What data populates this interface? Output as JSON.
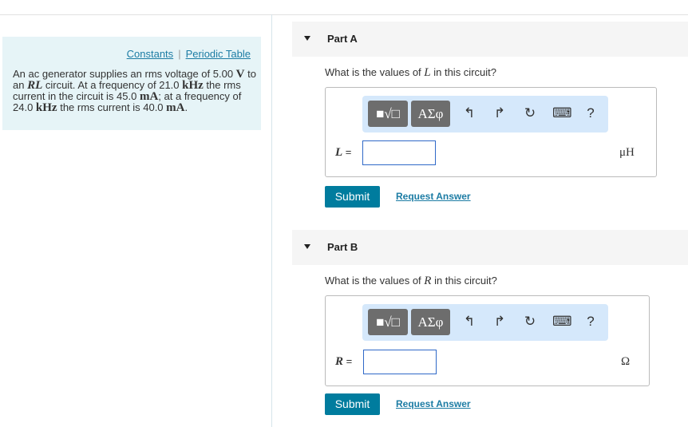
{
  "sidebar": {
    "constants_link": "Constants",
    "separator": "|",
    "periodic_link": "Periodic Table",
    "problem": {
      "t1": "An ac generator supplies an rms voltage of 5.00 ",
      "u1": "V",
      "t2": "to an ",
      "v1": "RL",
      "t3": " circuit. At a frequency of 21.0 ",
      "u2": "kHz",
      "t4": " the rms current in the circuit is 45.0 ",
      "u3": "mA",
      "t5": "; at a frequency of 24.0 ",
      "u4": "kHz",
      "t6": " the rms current is 40.0 ",
      "u5": "mA",
      "t7": "."
    }
  },
  "parts": [
    {
      "title": "Part A",
      "q1": "What is the values of ",
      "var": "L",
      "q2": " in this circuit?",
      "label_var": "L",
      "label_eq": " =",
      "input_value": "",
      "unit": "μH",
      "submit": "Submit",
      "request": "Request Answer"
    },
    {
      "title": "Part B",
      "q1": "What is the values of ",
      "var": "R",
      "q2": " in this circuit?",
      "label_var": "R",
      "label_eq": " =",
      "input_value": "",
      "unit": "Ω",
      "submit": "Submit",
      "request": "Request Answer"
    }
  ],
  "toolbar": {
    "templates": "■√□",
    "greek": "ΑΣφ",
    "undo": "↰",
    "redo": "↱",
    "reset": "↻",
    "keyboard": "⌨",
    "help": "?"
  }
}
